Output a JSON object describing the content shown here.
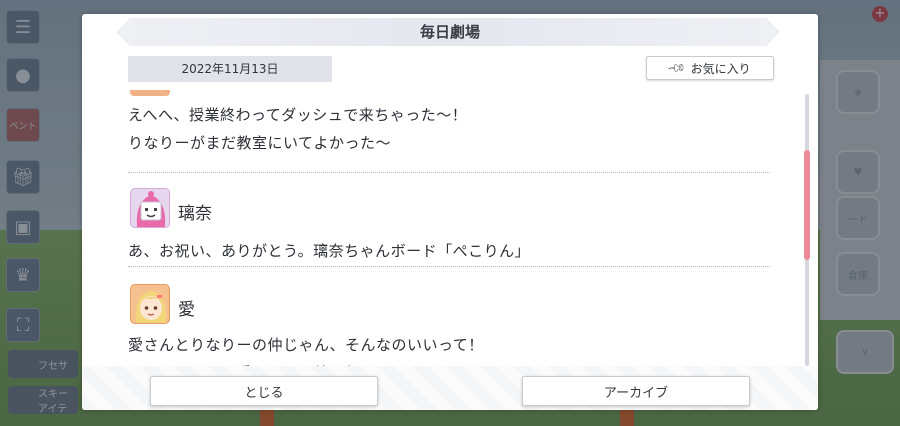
{
  "modal": {
    "title": "毎日劇場",
    "date": "2022年11月13日",
    "favorite_label": "お気に入り",
    "messages": [
      {
        "lines": [
          "えへへ、授業終わってダッシュで来ちゃった～！",
          "りなりーがまだ教室にいてよかった～"
        ]
      },
      {
        "speaker": "璃奈",
        "lines": [
          "あ、お祝い、ありがとう。璃奈ちゃんボード「ぺこりん」"
        ]
      },
      {
        "speaker": "愛",
        "lines": [
          "愛さんとりなりーの仲じゃん、そんなのいいって！",
          "よ～し、じゃあ愛さんと一緒に行こう！"
        ]
      }
    ],
    "close_label": "とじる",
    "archive_label": "アーカイブ"
  },
  "colors": {
    "scrollbar_thumb": "#ee8a97",
    "date_bg": "#e1e2ea",
    "rina_avatar_bg": "#e6d7ef",
    "ai_avatar_bg": "#f6c08f"
  },
  "background": {
    "left_chips": [
      "フセサ",
      "スキー アイテ"
    ],
    "right_button_labels": [
      "ード",
      "倉庫"
    ],
    "event_tag": "ベント"
  }
}
